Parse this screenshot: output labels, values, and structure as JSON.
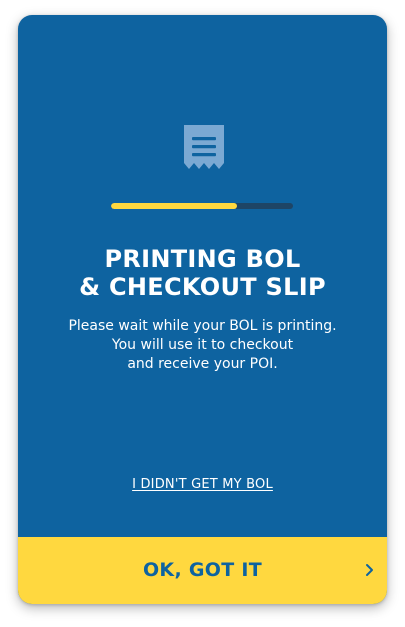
{
  "dialog": {
    "icon": "receipt-icon",
    "progress": 0.69,
    "title_line1": "PRINTING BOL",
    "title_line2": "& CHECKOUT SLIP",
    "message_line1": "Please wait while your BOL is printing.",
    "message_line2": "You will use it to checkout",
    "message_line3": "and receive your POI.",
    "link_label": "I DIDN'T GET MY BOL",
    "confirm_label": "OK, GOT IT",
    "confirm_icon": "chevron-right-icon"
  },
  "colors": {
    "background": "#0E63A0",
    "accent": "#FFD83F",
    "icon": "#7BA9D3",
    "track": "#1E4566"
  }
}
